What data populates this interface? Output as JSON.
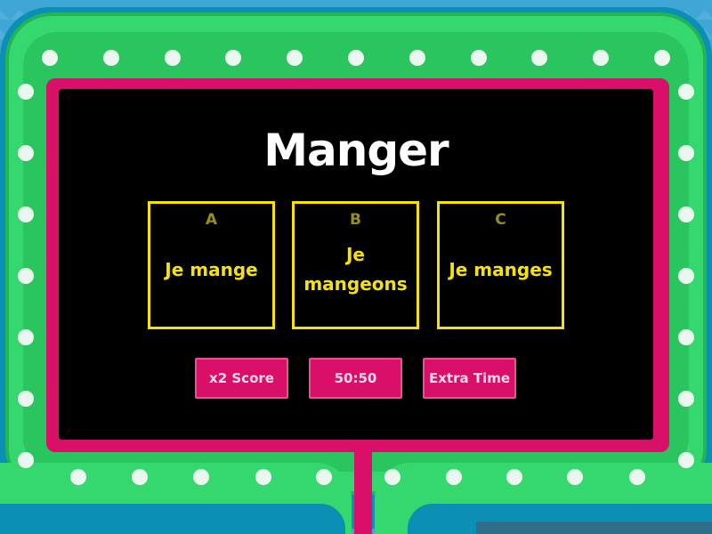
{
  "question": "Manger",
  "answers": [
    {
      "letter": "A",
      "text": "Je mange"
    },
    {
      "letter": "B",
      "text": "Je mangeons"
    },
    {
      "letter": "C",
      "text": "Je manges"
    }
  ],
  "powerups": [
    {
      "label": "x2 Score"
    },
    {
      "label": "50:50"
    },
    {
      "label": "Extra Time"
    }
  ],
  "colors": {
    "background": "#3fa6d6",
    "frame_green": "#34d86e",
    "frame_teal": "#0b8fb5",
    "screen_border": "#d8106a",
    "answer_yellow": "#f5e20a",
    "bulb": "#eaf7ef"
  }
}
